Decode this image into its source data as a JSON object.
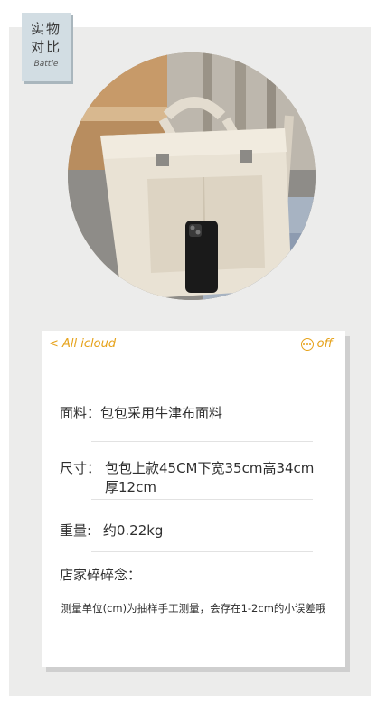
{
  "tag": {
    "line1": "实物",
    "line2": "对比",
    "line3": "Battle"
  },
  "notes_header": {
    "back": "< All icloud",
    "action": "off"
  },
  "specs": [
    {
      "label": "面料：",
      "value": "包包采用牛津布面料"
    },
    {
      "label": "尺寸：",
      "value": "包包上款45CM下宽35cm高34cm 厚12cm"
    },
    {
      "label": "重量:",
      "value": "约0.22kg"
    }
  ],
  "shop_notes": {
    "heading": "店家碎碎念：",
    "text": "测量单位(cm)为抽样手工测量，会存在1-2cm的小误差哦"
  }
}
